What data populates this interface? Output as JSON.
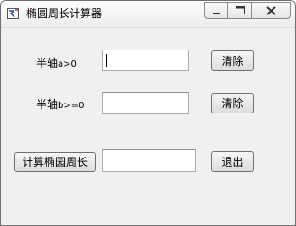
{
  "window": {
    "title": "椭圆周长计算器"
  },
  "form": {
    "semi_a_label": "半轴",
    "semi_a_cond": "a>0",
    "semi_a_value": "",
    "semi_b_label": "半轴",
    "semi_b_cond": "b>=0",
    "semi_b_value": "",
    "result_value": ""
  },
  "buttons": {
    "clear_a": "清除",
    "clear_b": "清除",
    "calculate": "计算椭园周长",
    "exit": "退出"
  },
  "icons": {
    "app": "app-icon",
    "minimize": "minimize-icon",
    "maximize": "maximize-icon",
    "close": "close-icon"
  }
}
